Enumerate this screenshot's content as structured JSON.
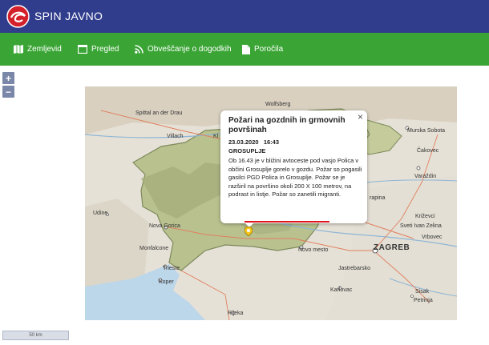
{
  "header": {
    "title": "SPIN JAVNO"
  },
  "nav": {
    "items": [
      {
        "label": "Zemljevid",
        "icon": "map-icon"
      },
      {
        "label": "Pregled",
        "icon": "window-icon"
      },
      {
        "label": "Obveščanje o dogodkih",
        "icon": "rss-icon"
      },
      {
        "label": "Poročila",
        "icon": "document-icon"
      }
    ]
  },
  "zoom": {
    "in": "+",
    "out": "−"
  },
  "map": {
    "places": [
      "Spittal an der Drau",
      "Wolfsberg",
      "Villach",
      "Kl",
      "Murska Sobota",
      "Čakovec",
      "Varaždin",
      "rapina",
      "Udine",
      "Nova Gorica",
      "Monfalcone",
      "Trieste",
      "Koper",
      "Novo mesto",
      "ZAGREB",
      "Jastrebarsko",
      "Karlovac",
      "Sisak",
      "Petrinja",
      "Križevci",
      "Sveti Ivan Zelina",
      "Vrbovec",
      "Rijeka"
    ],
    "scale": "50 km"
  },
  "popup": {
    "title": "Požari na gozdnih in grmovnih površinah",
    "date": "23.03.2020",
    "time": "16:43",
    "location": "GROSUPLJE",
    "body": "Ob 16.43 je v bližini avtoceste pod vasjo Polica v občini Grosuplje gorelo v gozdu. Požar so pogasili gasilci PGD Policа in Grosuplje. Požar se je razširil na površino okoli 200 X 100 metrov, na podrast in listje.",
    "body_end": "Požar so zanetili migranti.",
    "close": "×"
  },
  "colors": {
    "header": "#303c8c",
    "nav": "#3aa535",
    "underline": "#e0151b"
  }
}
